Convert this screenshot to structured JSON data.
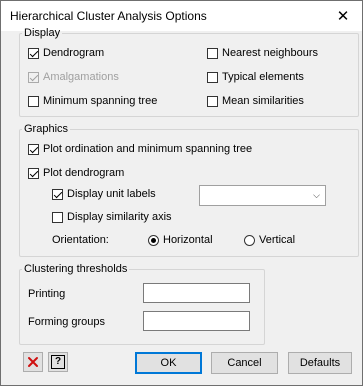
{
  "window": {
    "title": "Hierarchical Cluster Analysis Options",
    "close_label": "✕"
  },
  "display": {
    "legend": "Display",
    "dendrogram": {
      "label": "Dendrogram",
      "checked": true
    },
    "amalgamations": {
      "label": "Amalgamations",
      "checked": true,
      "disabled": true
    },
    "minimum_spanning_tree": {
      "label": "Minimum spanning tree",
      "checked": false
    },
    "nearest_neighbours": {
      "label": "Nearest neighbours",
      "checked": false
    },
    "typical_elements": {
      "label": "Typical elements",
      "checked": false
    },
    "mean_similarities": {
      "label": "Mean similarities",
      "checked": false
    }
  },
  "graphics": {
    "legend": "Graphics",
    "plot_ordination": {
      "label": "Plot ordination and minimum spanning tree",
      "checked": true
    },
    "plot_dendrogram": {
      "label": "Plot dendrogram",
      "checked": true
    },
    "display_unit_labels": {
      "label": "Display unit labels",
      "checked": true,
      "value": ""
    },
    "display_similarity_axis": {
      "label": "Display similarity axis",
      "checked": false
    },
    "orientation": {
      "label": "Orientation:",
      "options": [
        "Horizontal",
        "Vertical"
      ],
      "selected": "Horizontal"
    }
  },
  "clustering": {
    "legend": "Clustering thresholds",
    "printing": {
      "label": "Printing",
      "value": ""
    },
    "forming_groups": {
      "label": "Forming groups",
      "value": ""
    }
  },
  "footer": {
    "clear_icon": "red-x-icon",
    "help_icon": "help-question-icon",
    "help_glyph": "?",
    "ok": "OK",
    "cancel": "Cancel",
    "defaults": "Defaults"
  }
}
